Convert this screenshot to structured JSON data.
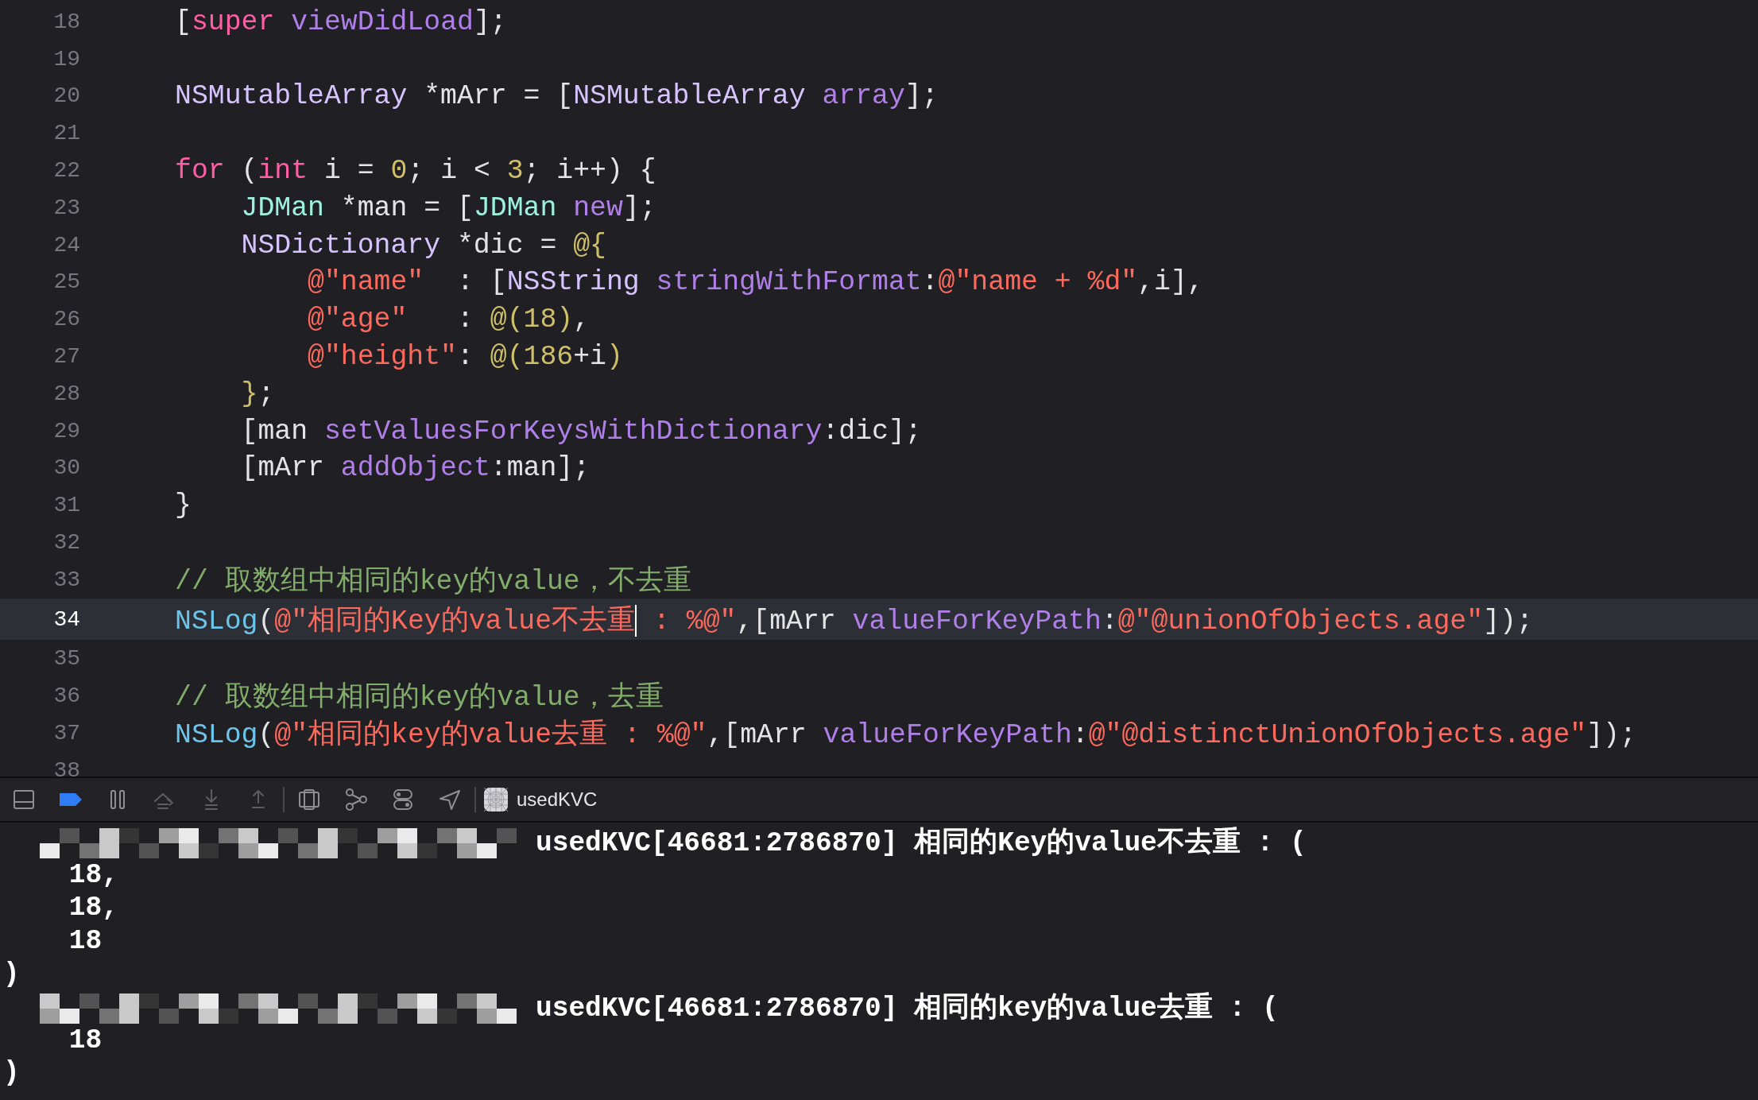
{
  "editor": {
    "lines": [
      {
        "number": "18",
        "current": false,
        "tokens": [
          {
            "kind": "plain",
            "text": "["
          },
          {
            "kind": "keyword",
            "text": "super"
          },
          {
            "kind": "method",
            "text": " viewDidLoad"
          },
          {
            "kind": "plain",
            "text": "];"
          }
        ]
      },
      {
        "number": "19",
        "current": false
      },
      {
        "number": "20",
        "current": false,
        "tokens": [
          {
            "kind": "class",
            "text": "NSMutableArray"
          },
          {
            "kind": "plain",
            "text": " *mArr = ["
          },
          {
            "kind": "class",
            "text": "NSMutableArray"
          },
          {
            "kind": "method",
            "text": " array"
          },
          {
            "kind": "plain",
            "text": "];"
          }
        ]
      },
      {
        "number": "21",
        "current": false
      },
      {
        "number": "22",
        "current": false,
        "tokens": [
          {
            "kind": "keyword",
            "text": "for"
          },
          {
            "kind": "plain",
            "text": " ("
          },
          {
            "kind": "keyword",
            "text": "int"
          },
          {
            "kind": "plain",
            "text": " i = "
          },
          {
            "kind": "number",
            "text": "0"
          },
          {
            "kind": "plain",
            "text": "; i < "
          },
          {
            "kind": "number",
            "text": "3"
          },
          {
            "kind": "plain",
            "text": "; i++) {"
          }
        ]
      },
      {
        "number": "23",
        "current": false,
        "tokens": [
          {
            "kind": "type",
            "text": "    JDMan"
          },
          {
            "kind": "plain",
            "text": " *man = ["
          },
          {
            "kind": "type",
            "text": "JDMan"
          },
          {
            "kind": "method",
            "text": " new"
          },
          {
            "kind": "plain",
            "text": "];"
          }
        ]
      },
      {
        "number": "24",
        "current": false,
        "tokens": [
          {
            "kind": "class",
            "text": "    NSDictionary"
          },
          {
            "kind": "plain",
            "text": " *dic = "
          },
          {
            "kind": "number",
            "text": "@{"
          }
        ]
      },
      {
        "number": "25",
        "current": false,
        "tokens": [
          {
            "kind": "string",
            "text": "        @\"name\""
          },
          {
            "kind": "plain",
            "text": "  : ["
          },
          {
            "kind": "class",
            "text": "NSString"
          },
          {
            "kind": "method",
            "text": " stringWithFormat"
          },
          {
            "kind": "plain",
            "text": ":"
          },
          {
            "kind": "string",
            "text": "@\"name + %d\""
          },
          {
            "kind": "plain",
            "text": ",i],"
          }
        ]
      },
      {
        "number": "26",
        "current": false,
        "tokens": [
          {
            "kind": "string",
            "text": "        @\"age\""
          },
          {
            "kind": "plain",
            "text": "   : "
          },
          {
            "kind": "number",
            "text": "@(18)"
          },
          {
            "kind": "plain",
            "text": ","
          }
        ]
      },
      {
        "number": "27",
        "current": false,
        "tokens": [
          {
            "kind": "string",
            "text": "        @\"height\""
          },
          {
            "kind": "plain",
            "text": ": "
          },
          {
            "kind": "number",
            "text": "@(186"
          },
          {
            "kind": "plain",
            "text": "+i"
          },
          {
            "kind": "number",
            "text": ")"
          }
        ]
      },
      {
        "number": "28",
        "current": false,
        "tokens": [
          {
            "kind": "number",
            "text": "    }"
          },
          {
            "kind": "plain",
            "text": ";"
          }
        ]
      },
      {
        "number": "29",
        "current": false,
        "tokens": [
          {
            "kind": "plain",
            "text": "    [man "
          },
          {
            "kind": "method",
            "text": "setValuesForKeysWithDictionary"
          },
          {
            "kind": "plain",
            "text": ":dic];"
          }
        ]
      },
      {
        "number": "30",
        "current": false,
        "tokens": [
          {
            "kind": "plain",
            "text": "    [mArr "
          },
          {
            "kind": "method",
            "text": "addObject"
          },
          {
            "kind": "plain",
            "text": ":man];"
          }
        ]
      },
      {
        "number": "31",
        "current": false,
        "tokens": [
          {
            "kind": "plain",
            "text": "}"
          }
        ]
      },
      {
        "number": "32",
        "current": false
      },
      {
        "number": "33",
        "current": false,
        "tokens": [
          {
            "kind": "comment",
            "text": "// 取数组中相同的key的value，不去重"
          }
        ]
      },
      {
        "number": "34",
        "current": true,
        "tokens": [
          {
            "kind": "function",
            "text": "NSLog"
          },
          {
            "kind": "plain",
            "text": "("
          },
          {
            "kind": "string",
            "text": "@\"相同的Key的value不去重"
          },
          {
            "kind": "cursor"
          },
          {
            "kind": "string",
            "text": " : %@\""
          },
          {
            "kind": "plain",
            "text": ",[mArr "
          },
          {
            "kind": "method",
            "text": "valueForKeyPath"
          },
          {
            "kind": "plain",
            "text": ":"
          },
          {
            "kind": "string",
            "text": "@\"@unionOfObjects.age\""
          },
          {
            "kind": "plain",
            "text": "]);"
          }
        ]
      },
      {
        "number": "35",
        "current": false
      },
      {
        "number": "36",
        "current": false,
        "tokens": [
          {
            "kind": "comment",
            "text": "// 取数组中相同的key的value，去重"
          }
        ]
      },
      {
        "number": "37",
        "current": false,
        "tokens": [
          {
            "kind": "function",
            "text": "NSLog"
          },
          {
            "kind": "plain",
            "text": "("
          },
          {
            "kind": "string",
            "text": "@\"相同的key的value去重 : %@\""
          },
          {
            "kind": "plain",
            "text": ",[mArr "
          },
          {
            "kind": "method",
            "text": "valueForKeyPath"
          },
          {
            "kind": "plain",
            "text": ":"
          },
          {
            "kind": "string",
            "text": "@\"@distinctUnionOfObjects.age\""
          },
          {
            "kind": "plain",
            "text": "]);"
          }
        ]
      },
      {
        "number": "38",
        "current": false
      }
    ]
  },
  "debug_bar": {
    "breakpoints_active": true,
    "target": "usedKVC"
  },
  "console": {
    "lines": [
      {
        "kind": "log",
        "text": "usedKVC[46681:2786870] 相同的Key的value不去重 : ("
      },
      {
        "kind": "plain",
        "text": "    18,"
      },
      {
        "kind": "plain",
        "text": "    18,"
      },
      {
        "kind": "plain",
        "text": "    18"
      },
      {
        "kind": "plain",
        "text": ")"
      },
      {
        "kind": "log",
        "text": "usedKVC[46681:2786870] 相同的key的value去重 : ("
      },
      {
        "kind": "plain",
        "text": "    18"
      },
      {
        "kind": "plain",
        "text": ")"
      }
    ]
  }
}
